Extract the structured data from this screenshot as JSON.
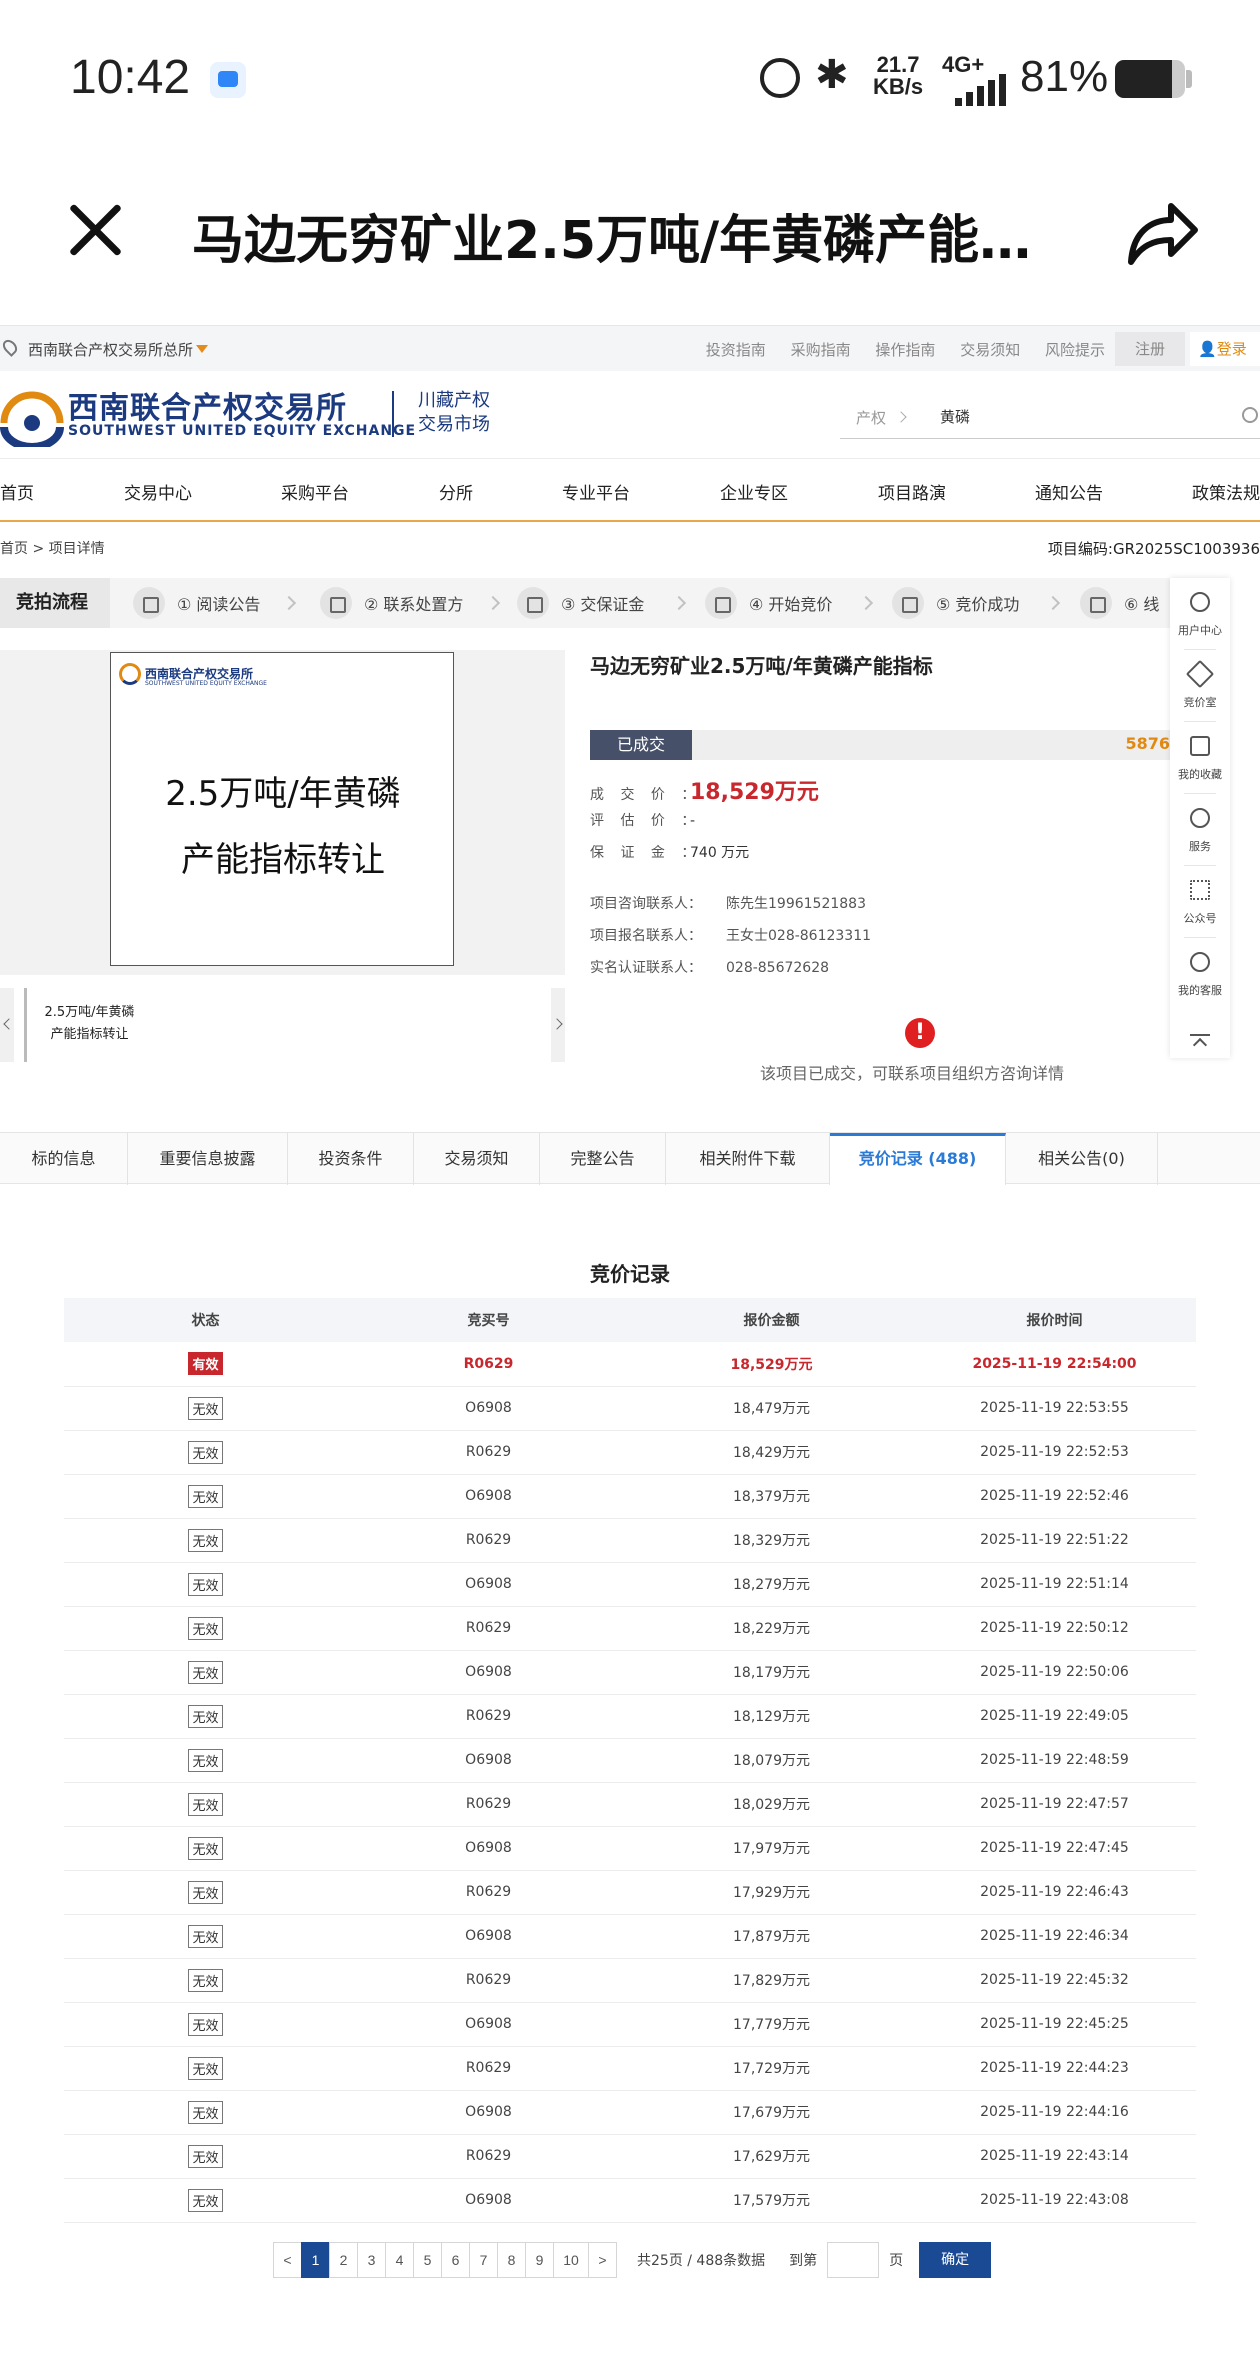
{
  "status_bar": {
    "time": "10:42",
    "speed_value": "21.7",
    "speed_unit": "KB/s",
    "network": "4G+",
    "battery_text": "81%",
    "battery_level": 0.81
  },
  "app_header": {
    "title": "马边无穷矿业2.5万吨/年黄磷产能…"
  },
  "top_bar": {
    "org_name": "西南联合产权交易所总所",
    "links": [
      "投资指南",
      "采购指南",
      "操作指南",
      "交易须知",
      "风险提示"
    ],
    "register": "注册",
    "login": "登录"
  },
  "logo": {
    "name_cn": "西南联合产权交易所",
    "name_en": "SOUTHWEST UNITED EQUITY EXCHANGE",
    "sub_line1": "川藏产权",
    "sub_line2": "交易市场"
  },
  "search": {
    "category": "产权",
    "value": "黄磷"
  },
  "nav": [
    "首页",
    "交易中心",
    "采购平台",
    "分所",
    "专业平台",
    "企业专区",
    "项目路演",
    "通知公告",
    "政策法规"
  ],
  "breadcrumb": {
    "path": "首页 > 项目详情",
    "code": "项目编码:GR2025SC1003936"
  },
  "process": {
    "title": "竞拍流程",
    "steps": [
      "① 阅读公告",
      "② 联系处置方",
      "③ 交保证金",
      "④ 开始竞价",
      "⑤ 竞价成功",
      "⑥ 线"
    ]
  },
  "gallery": {
    "card_logo": "西南联合产权交易所",
    "card_logo_en": "SOUTHWEST UNITED EQUITY EXCHANGE",
    "card_line1": "2.5万吨/年黄磷",
    "card_line2": "产能指标转让",
    "thumb_line1": "2.5万吨/年黄磷",
    "thumb_line2": "产能指标转让"
  },
  "project": {
    "title": "马边无穷矿业2.5万吨/年黄磷产能指标",
    "status": "已成交",
    "status_number": "5876",
    "deal_price_label": "成 交 价 ：",
    "deal_price": "18,529万元",
    "eval_price_label": "评 估 价 ：",
    "eval_price": "-",
    "deposit_label": "保 证 金 ：",
    "deposit": "740 万元",
    "consult_label": "项目咨询联系人：",
    "consult": "陈先生19961521883",
    "signup_label": "项目报名联系人：",
    "signup": "王女士028-86123311",
    "verify_label": "实名认证联系人：",
    "verify": "028-85672628",
    "notice": "该项目已成交，可联系项目组织方咨询详情"
  },
  "float_bar": {
    "items": [
      "用户中心",
      "竞价室",
      "我的收藏",
      "服务",
      "公众号",
      "我的客服"
    ]
  },
  "tabs": [
    "标的信息",
    "重要信息披露",
    "投资条件",
    "交易须知",
    "完整公告",
    "相关附件下载",
    "竞价记录 (488)",
    "相关公告(0)"
  ],
  "bid_records": {
    "title": "竞价记录",
    "columns": [
      "状态",
      "竞买号",
      "报价金额",
      "报价时间"
    ],
    "rows": [
      [
        "有效",
        "R0629",
        "18,529万元",
        "2025-11-19 22:54:00"
      ],
      [
        "无效",
        "O6908",
        "18,479万元",
        "2025-11-19 22:53:55"
      ],
      [
        "无效",
        "R0629",
        "18,429万元",
        "2025-11-19 22:52:53"
      ],
      [
        "无效",
        "O6908",
        "18,379万元",
        "2025-11-19 22:52:46"
      ],
      [
        "无效",
        "R0629",
        "18,329万元",
        "2025-11-19 22:51:22"
      ],
      [
        "无效",
        "O6908",
        "18,279万元",
        "2025-11-19 22:51:14"
      ],
      [
        "无效",
        "R0629",
        "18,229万元",
        "2025-11-19 22:50:12"
      ],
      [
        "无效",
        "O6908",
        "18,179万元",
        "2025-11-19 22:50:06"
      ],
      [
        "无效",
        "R0629",
        "18,129万元",
        "2025-11-19 22:49:05"
      ],
      [
        "无效",
        "O6908",
        "18,079万元",
        "2025-11-19 22:48:59"
      ],
      [
        "无效",
        "R0629",
        "18,029万元",
        "2025-11-19 22:47:57"
      ],
      [
        "无效",
        "O6908",
        "17,979万元",
        "2025-11-19 22:47:45"
      ],
      [
        "无效",
        "R0629",
        "17,929万元",
        "2025-11-19 22:46:43"
      ],
      [
        "无效",
        "O6908",
        "17,879万元",
        "2025-11-19 22:46:34"
      ],
      [
        "无效",
        "R0629",
        "17,829万元",
        "2025-11-19 22:45:32"
      ],
      [
        "无效",
        "O6908",
        "17,779万元",
        "2025-11-19 22:45:25"
      ],
      [
        "无效",
        "R0629",
        "17,729万元",
        "2025-11-19 22:44:23"
      ],
      [
        "无效",
        "O6908",
        "17,679万元",
        "2025-11-19 22:44:16"
      ],
      [
        "无效",
        "R0629",
        "17,629万元",
        "2025-11-19 22:43:14"
      ],
      [
        "无效",
        "O6908",
        "17,579万元",
        "2025-11-19 22:43:08"
      ]
    ]
  },
  "pagination": {
    "prev": "<",
    "pages": [
      "1",
      "2",
      "3",
      "4",
      "5",
      "6",
      "7",
      "8",
      "9",
      "10"
    ],
    "next": ">",
    "summary": "共25页 / 488条数据",
    "goto_label": "到第",
    "page_unit": "页",
    "confirm": "确定"
  }
}
